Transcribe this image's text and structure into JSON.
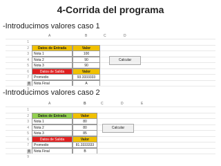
{
  "slide": {
    "title": "4-Corrida del programa",
    "case1_caption": "-Introducimos valores caso 1",
    "case2_caption": "-Introducimos valores caso 2"
  },
  "sheet1": {
    "columns": [
      "A",
      "B",
      "C",
      "D"
    ],
    "rows": [
      {
        "num": "1",
        "a": "",
        "b": ""
      },
      {
        "num": "2",
        "a": "Datos de Entrada",
        "b": "Valor"
      },
      {
        "num": "3",
        "a": "Nota 1",
        "b": "100"
      },
      {
        "num": "4",
        "a": "Nota 2",
        "b": "90"
      },
      {
        "num": "5",
        "a": "Nota 3",
        "b": "90"
      },
      {
        "num": "6",
        "a": "Datos de Salida",
        "b": "Valor"
      },
      {
        "num": "7",
        "a": "Promedio",
        "b": "93.3333333"
      },
      {
        "num": "8",
        "a": "Nota Final",
        "b": "A"
      },
      {
        "num": "9",
        "a": "",
        "b": ""
      }
    ],
    "button_label": "Calcular"
  },
  "sheet2": {
    "columns": [
      "A",
      "B",
      "C",
      "D",
      "E"
    ],
    "rows": [
      {
        "num": "1",
        "a": "",
        "b": ""
      },
      {
        "num": "2",
        "a": "Datos de Entrada",
        "b": "Valor"
      },
      {
        "num": "3",
        "a": "Nota 1",
        "b": "80"
      },
      {
        "num": "4",
        "a": "Nota 2",
        "b": "80"
      },
      {
        "num": "5",
        "a": "Nota 3",
        "b": "85"
      },
      {
        "num": "6",
        "a": "Datos de Salida",
        "b": "Valor"
      },
      {
        "num": "7",
        "a": "Promedio",
        "b": "81.3333333"
      },
      {
        "num": "8",
        "a": "Nota Final",
        "b": "B"
      },
      {
        "num": "9",
        "a": "",
        "b": ""
      }
    ],
    "button_label": "Calcular"
  },
  "colors": {
    "header_yellow": "#f0c000",
    "input_green": "#92d050",
    "output_red": "#e02020"
  }
}
